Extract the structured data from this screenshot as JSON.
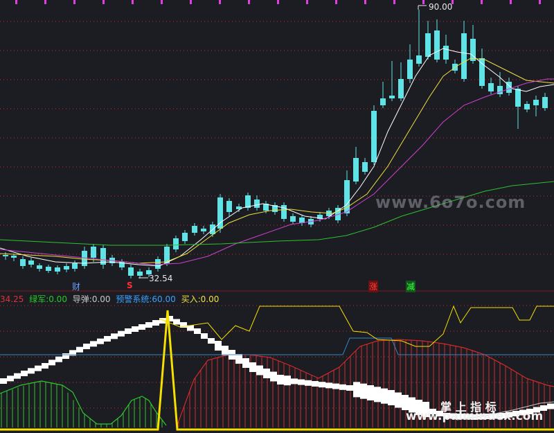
{
  "price_panel": {
    "high_label": "90.00",
    "low_label": "32.54",
    "markers": [
      {
        "text": "财",
        "color": "#6aa0ff"
      },
      {
        "text": "S",
        "color": "#ff3030"
      },
      {
        "text": "涨",
        "color": "#ff4040",
        "bg": "#6a1010"
      },
      {
        "text": "减",
        "color": "#44ff44",
        "bg": "#0f5a1a"
      }
    ],
    "watermark": "www.6o7o.com",
    "colors": {
      "up": "#e0303a",
      "down": "#5fe3e6",
      "ma5": "#ffffff",
      "ma10": "#f0e040",
      "ma20": "#d040d0",
      "ma60": "#30c030",
      "grid": "#d22a2a"
    }
  },
  "indicator_bar": {
    "first_value": "34.25",
    "items": [
      {
        "label": "绿军:",
        "value": "0.00",
        "color": "#22cc22"
      },
      {
        "label": "导弹:",
        "value": "0.00",
        "color": "#c8c8c8"
      },
      {
        "label": "预警系统:",
        "value": "60.00",
        "color": "#3aa0ff"
      },
      {
        "label": "买入:",
        "value": "0.00",
        "color": "#f0e040"
      }
    ]
  },
  "indicator_panel": {
    "colors": {
      "green_bars": "#2ec82e",
      "red_bars": "#d42a2a",
      "yellow": "#f5e000",
      "blue": "#2f86c8",
      "white": "#ffffff"
    }
  },
  "branding": {
    "cn_text": "掌 上 指 标",
    "url_text": "www.palmindex.com"
  }
}
